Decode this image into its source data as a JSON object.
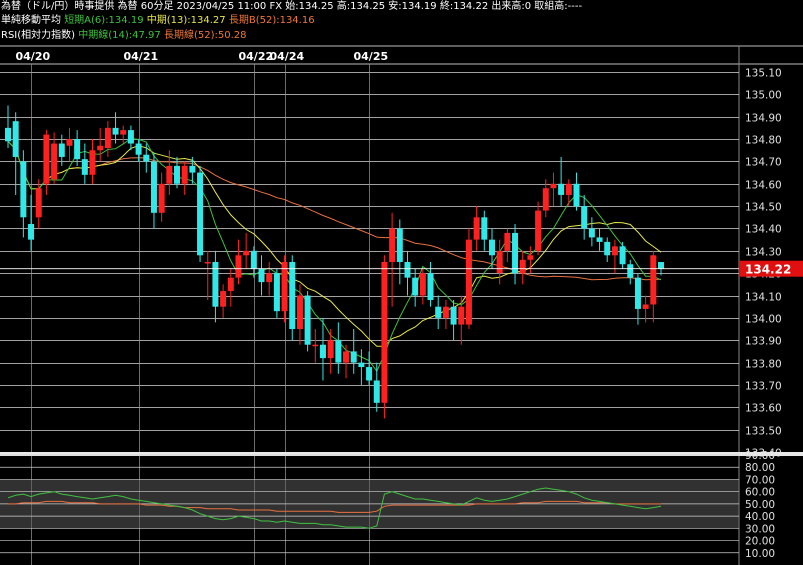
{
  "header": {
    "line1": "為替（ドル/円）時事提供 為替 60分足 2023/04/25 11:00 FX 始:134.25 高:134.25 安:134.19 終:134.22 出来高:0 取組高:----",
    "ma_title": "単純移動平均",
    "ma_short": "短期A(6):134.19",
    "ma_mid": "中期(13):134.27",
    "ma_long": "長期B(52):134.16",
    "rsi_title": "RSI(相対力指数)",
    "rsi_mid": "中期線(14):47.97",
    "rsi_long": "長期線(52):50.28"
  },
  "chart_data": {
    "type": "candlestick",
    "dates": [
      "04/20",
      "04/21",
      "04/22",
      "04/24",
      "04/25"
    ],
    "date_candle_index": [
      3,
      17,
      32,
      36,
      47
    ],
    "price_axis": {
      "min": 133.4,
      "max": 135.1,
      "ticks": [
        "135.10",
        "135.00",
        "134.90",
        "134.80",
        "134.70",
        "134.60",
        "134.50",
        "134.40",
        "134.30",
        "134.20",
        "134.10",
        "134.00",
        "133.90",
        "133.80",
        "133.70",
        "133.60",
        "133.50",
        "133.40"
      ]
    },
    "current_price": "134.22",
    "candles": [
      {
        "o": 134.85,
        "h": 134.95,
        "l": 134.76,
        "c": 134.79
      },
      {
        "o": 134.88,
        "h": 134.92,
        "l": 134.55,
        "c": 134.72
      },
      {
        "o": 134.7,
        "h": 134.75,
        "l": 134.36,
        "c": 134.45
      },
      {
        "o": 134.42,
        "h": 134.55,
        "l": 134.3,
        "c": 134.35
      },
      {
        "o": 134.45,
        "h": 134.62,
        "l": 134.4,
        "c": 134.58
      },
      {
        "o": 134.6,
        "h": 134.84,
        "l": 134.55,
        "c": 134.82
      },
      {
        "o": 134.62,
        "h": 134.83,
        "l": 134.6,
        "c": 134.78
      },
      {
        "o": 134.78,
        "h": 134.82,
        "l": 134.68,
        "c": 134.72
      },
      {
        "o": 134.77,
        "h": 134.85,
        "l": 134.7,
        "c": 134.8
      },
      {
        "o": 134.8,
        "h": 134.84,
        "l": 134.68,
        "c": 134.71
      },
      {
        "o": 134.71,
        "h": 134.78,
        "l": 134.6,
        "c": 134.64
      },
      {
        "o": 134.64,
        "h": 134.8,
        "l": 134.6,
        "c": 134.75
      },
      {
        "o": 134.75,
        "h": 134.85,
        "l": 134.7,
        "c": 134.77
      },
      {
        "o": 134.76,
        "h": 134.88,
        "l": 134.72,
        "c": 134.85
      },
      {
        "o": 134.85,
        "h": 134.92,
        "l": 134.78,
        "c": 134.82
      },
      {
        "o": 134.82,
        "h": 134.86,
        "l": 134.78,
        "c": 134.84
      },
      {
        "o": 134.84,
        "h": 134.86,
        "l": 134.75,
        "c": 134.78
      },
      {
        "o": 134.78,
        "h": 134.8,
        "l": 134.7,
        "c": 134.73
      },
      {
        "o": 134.73,
        "h": 134.78,
        "l": 134.65,
        "c": 134.7
      },
      {
        "o": 134.7,
        "h": 134.74,
        "l": 134.4,
        "c": 134.47
      },
      {
        "o": 134.47,
        "h": 134.65,
        "l": 134.43,
        "c": 134.6
      },
      {
        "o": 134.6,
        "h": 134.75,
        "l": 134.55,
        "c": 134.68
      },
      {
        "o": 134.68,
        "h": 134.72,
        "l": 134.58,
        "c": 134.6
      },
      {
        "o": 134.6,
        "h": 134.7,
        "l": 134.55,
        "c": 134.68
      },
      {
        "o": 134.68,
        "h": 134.72,
        "l": 134.6,
        "c": 134.65
      },
      {
        "o": 134.65,
        "h": 134.68,
        "l": 134.25,
        "c": 134.28
      },
      {
        "o": 134.25,
        "h": 134.3,
        "l": 134.08,
        "c": 134.25
      },
      {
        "o": 134.25,
        "h": 134.3,
        "l": 133.98,
        "c": 134.05
      },
      {
        "o": 134.05,
        "h": 134.15,
        "l": 134.0,
        "c": 134.12
      },
      {
        "o": 134.12,
        "h": 134.22,
        "l": 134.05,
        "c": 134.18
      },
      {
        "o": 134.18,
        "h": 134.35,
        "l": 134.15,
        "c": 134.28
      },
      {
        "o": 134.28,
        "h": 134.38,
        "l": 134.22,
        "c": 134.3
      },
      {
        "o": 134.3,
        "h": 134.32,
        "l": 134.18,
        "c": 134.22
      },
      {
        "o": 134.22,
        "h": 134.28,
        "l": 134.1,
        "c": 134.16
      },
      {
        "o": 134.16,
        "h": 134.25,
        "l": 134.1,
        "c": 134.2
      },
      {
        "o": 134.2,
        "h": 134.22,
        "l": 134.0,
        "c": 134.03
      },
      {
        "o": 134.03,
        "h": 134.28,
        "l": 133.98,
        "c": 134.25
      },
      {
        "o": 134.25,
        "h": 134.28,
        "l": 133.9,
        "c": 133.95
      },
      {
        "o": 133.95,
        "h": 134.15,
        "l": 133.88,
        "c": 134.1
      },
      {
        "o": 134.1,
        "h": 134.12,
        "l": 133.85,
        "c": 133.88
      },
      {
        "o": 133.88,
        "h": 133.95,
        "l": 133.8,
        "c": 133.88
      },
      {
        "o": 133.88,
        "h": 134.0,
        "l": 133.72,
        "c": 133.82
      },
      {
        "o": 133.82,
        "h": 133.95,
        "l": 133.75,
        "c": 133.9
      },
      {
        "o": 133.9,
        "h": 133.98,
        "l": 133.75,
        "c": 133.8
      },
      {
        "o": 133.8,
        "h": 133.88,
        "l": 133.73,
        "c": 133.85
      },
      {
        "o": 133.85,
        "h": 133.95,
        "l": 133.75,
        "c": 133.8
      },
      {
        "o": 133.8,
        "h": 133.86,
        "l": 133.7,
        "c": 133.78
      },
      {
        "o": 133.78,
        "h": 133.85,
        "l": 133.7,
        "c": 133.72
      },
      {
        "o": 133.72,
        "h": 133.8,
        "l": 133.58,
        "c": 133.62
      },
      {
        "o": 133.62,
        "h": 134.28,
        "l": 133.55,
        "c": 134.25
      },
      {
        "o": 134.25,
        "h": 134.47,
        "l": 134.05,
        "c": 134.4
      },
      {
        "o": 134.4,
        "h": 134.44,
        "l": 134.15,
        "c": 134.25
      },
      {
        "o": 134.25,
        "h": 134.3,
        "l": 134.1,
        "c": 134.18
      },
      {
        "o": 134.18,
        "h": 134.22,
        "l": 134.05,
        "c": 134.1
      },
      {
        "o": 134.1,
        "h": 134.22,
        "l": 134.06,
        "c": 134.2
      },
      {
        "o": 134.2,
        "h": 134.25,
        "l": 134.05,
        "c": 134.08
      },
      {
        "o": 134.05,
        "h": 134.1,
        "l": 133.95,
        "c": 134.0
      },
      {
        "o": 134.0,
        "h": 134.08,
        "l": 133.95,
        "c": 134.05
      },
      {
        "o": 134.05,
        "h": 134.08,
        "l": 133.9,
        "c": 133.97
      },
      {
        "o": 133.97,
        "h": 134.1,
        "l": 133.88,
        "c": 134.05
      },
      {
        "o": 133.97,
        "h": 134.4,
        "l": 133.95,
        "c": 134.35
      },
      {
        "o": 134.35,
        "h": 134.5,
        "l": 134.3,
        "c": 134.45
      },
      {
        "o": 134.45,
        "h": 134.48,
        "l": 134.3,
        "c": 134.35
      },
      {
        "o": 134.35,
        "h": 134.4,
        "l": 134.22,
        "c": 134.28
      },
      {
        "o": 134.2,
        "h": 134.35,
        "l": 134.15,
        "c": 134.3
      },
      {
        "o": 134.3,
        "h": 134.4,
        "l": 134.25,
        "c": 134.38
      },
      {
        "o": 134.38,
        "h": 134.42,
        "l": 134.15,
        "c": 134.2
      },
      {
        "o": 134.2,
        "h": 134.3,
        "l": 134.15,
        "c": 134.26
      },
      {
        "o": 134.26,
        "h": 134.32,
        "l": 134.2,
        "c": 134.28
      },
      {
        "o": 134.3,
        "h": 134.52,
        "l": 134.28,
        "c": 134.48
      },
      {
        "o": 134.48,
        "h": 134.62,
        "l": 134.45,
        "c": 134.58
      },
      {
        "o": 134.58,
        "h": 134.65,
        "l": 134.5,
        "c": 134.6
      },
      {
        "o": 134.6,
        "h": 134.72,
        "l": 134.5,
        "c": 134.55
      },
      {
        "o": 134.55,
        "h": 134.62,
        "l": 134.5,
        "c": 134.6
      },
      {
        "o": 134.6,
        "h": 134.65,
        "l": 134.48,
        "c": 134.5
      },
      {
        "o": 134.5,
        "h": 134.55,
        "l": 134.35,
        "c": 134.4
      },
      {
        "o": 134.4,
        "h": 134.45,
        "l": 134.32,
        "c": 134.36
      },
      {
        "o": 134.36,
        "h": 134.4,
        "l": 134.3,
        "c": 134.34
      },
      {
        "o": 134.34,
        "h": 134.36,
        "l": 134.25,
        "c": 134.28
      },
      {
        "o": 134.28,
        "h": 134.35,
        "l": 134.2,
        "c": 134.32
      },
      {
        "o": 134.32,
        "h": 134.34,
        "l": 134.22,
        "c": 134.24
      },
      {
        "o": 134.24,
        "h": 134.26,
        "l": 134.15,
        "c": 134.18
      },
      {
        "o": 134.18,
        "h": 134.2,
        "l": 133.97,
        "c": 134.04
      },
      {
        "o": 134.04,
        "h": 134.1,
        "l": 133.98,
        "c": 134.06
      },
      {
        "o": 134.06,
        "h": 134.3,
        "l": 133.98,
        "c": 134.28
      },
      {
        "o": 134.25,
        "h": 134.25,
        "l": 134.19,
        "c": 134.22
      }
    ],
    "rsi_axis": {
      "min": 0,
      "max": 90,
      "ticks": [
        "90.00",
        "80.00",
        "70.00",
        "60.00",
        "50.00",
        "40.00",
        "30.00",
        "20.00",
        "10.00"
      ]
    },
    "rsi_mid": [
      55,
      57,
      58,
      56,
      58,
      59,
      60,
      58,
      57,
      56,
      55,
      54,
      55,
      56,
      57,
      56,
      54,
      53,
      52,
      51,
      50,
      49,
      48,
      47,
      45,
      42,
      40,
      38,
      37,
      38,
      40,
      39,
      38,
      36,
      36,
      35,
      36,
      35,
      34,
      34,
      34,
      33,
      33,
      32,
      31,
      31,
      31,
      30,
      32,
      58,
      60,
      58,
      56,
      54,
      54,
      53,
      52,
      51,
      50,
      49,
      52,
      55,
      53,
      52,
      53,
      54,
      56,
      58,
      60,
      62,
      63,
      62,
      61,
      60,
      58,
      55,
      53,
      52,
      51,
      50,
      49,
      48,
      47,
      46,
      47,
      48
    ],
    "rsi_long": [
      50,
      50,
      51,
      51,
      51,
      52,
      52,
      52,
      51,
      51,
      51,
      51,
      50,
      50,
      50,
      50,
      50,
      50,
      49,
      49,
      49,
      48,
      48,
      47,
      47,
      47,
      46,
      46,
      46,
      46,
      45,
      45,
      45,
      45,
      45,
      44,
      44,
      44,
      44,
      44,
      44,
      44,
      44,
      43,
      43,
      43,
      43,
      43,
      44,
      48,
      49,
      49,
      49,
      49,
      49,
      49,
      49,
      49,
      49,
      49,
      49,
      50,
      50,
      50,
      50,
      50,
      50,
      51,
      51,
      51,
      52,
      52,
      52,
      52,
      52,
      51,
      51,
      51,
      51,
      50,
      50,
      50,
      50,
      50,
      50,
      50
    ]
  }
}
